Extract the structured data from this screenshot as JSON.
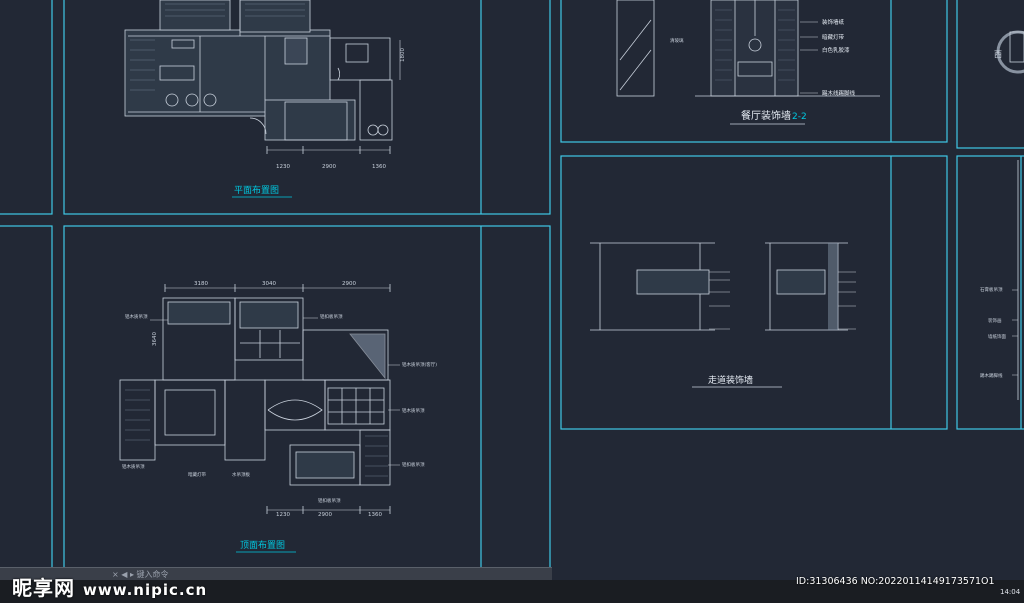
{
  "plans": {
    "top_plan": {
      "title": "平面布置图",
      "dims": [
        "1230",
        "2900",
        "1360"
      ],
      "side_dim": "1800"
    },
    "bottom_plan": {
      "title": "顶面布置图",
      "top_dims": [
        "3180",
        "3040",
        "2900"
      ],
      "bottom_dims": [
        "1230",
        "2900",
        "1360"
      ],
      "side_dim": "3640",
      "labels": [
        "铝木质吊顶",
        "铝扣板吊顶",
        "铝木质吊顶(客厅)",
        "铝木质吊顶",
        "铝扣板吊顶",
        "铝扣板吊顶",
        "铝木质吊顶",
        "暗藏灯带",
        "水吊顶板"
      ]
    }
  },
  "elevations": {
    "dining_wall": {
      "title": "餐厅装饰墙",
      "scale": "2-2",
      "notes": [
        "装饰墙纸",
        "暗藏灯带",
        "白色乳胶漆",
        "踢木线踢脚线"
      ],
      "left_note": "清玻璃"
    },
    "corridor_wall": {
      "title": "走道装饰墙"
    },
    "right_panel": {
      "compass": "西",
      "notes": [
        "石膏板吊顶",
        "装饰画",
        "墙纸饰面",
        "踢木踢脚线"
      ]
    }
  },
  "command_line": {
    "text": "× ◀ ▸ 键入命令"
  },
  "watermark": {
    "logo": "昵享网",
    "url": "www.nipic.cn"
  },
  "image_id": {
    "text": "ID:31306436 NO:20220114149173571O1"
  },
  "taskbar": {
    "time": "14:04"
  },
  "colors": {
    "background": "#222835",
    "frame_line": "#3fc8e6",
    "drawing_line": "#c9d1dc",
    "title_color": "#00c8e0"
  }
}
